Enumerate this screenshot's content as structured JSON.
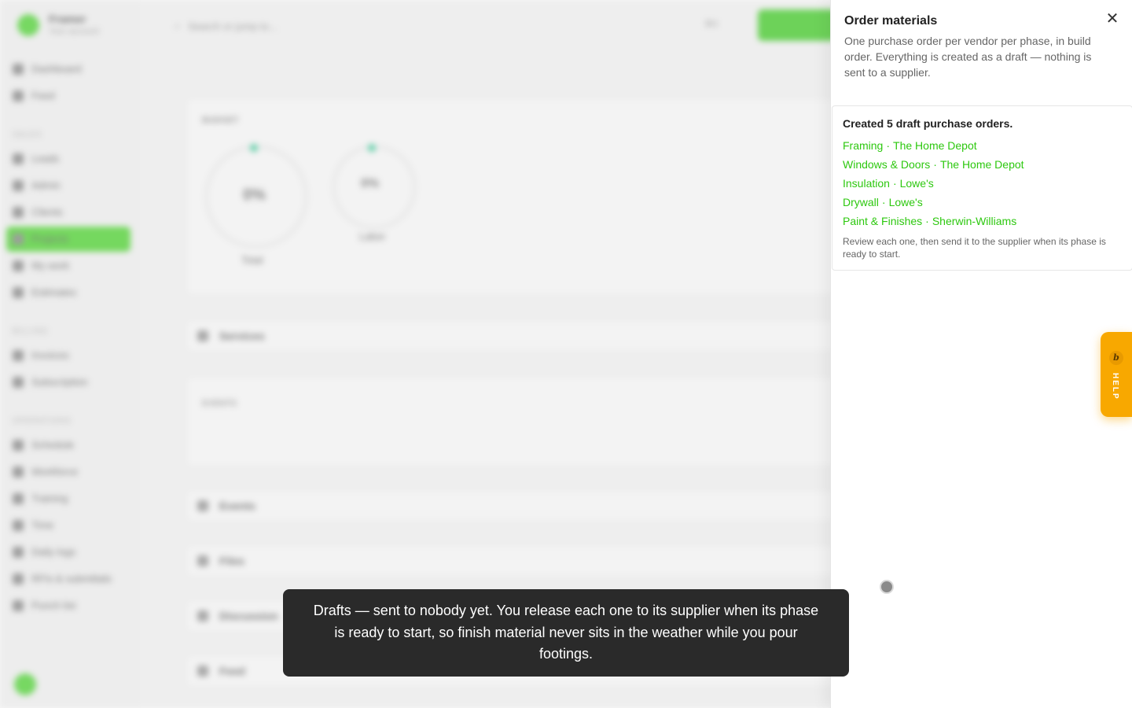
{
  "drawer": {
    "title": "Order materials",
    "description": "One purchase order per vendor per phase, in build order. Everything is created as a draft — nothing is sent to a supplier.",
    "close_icon": "close-icon",
    "result": {
      "heading": "Created 5 draft purchase orders.",
      "orders": [
        {
          "phase": "Framing",
          "vendor": "The Home Depot"
        },
        {
          "phase": "Windows & Doors",
          "vendor": "The Home Depot"
        },
        {
          "phase": "Insulation",
          "vendor": "Lowe's"
        },
        {
          "phase": "Drywall",
          "vendor": "Lowe's"
        },
        {
          "phase": "Paint & Finishes",
          "vendor": "Sherwin-Williams"
        }
      ],
      "separator": "·",
      "note": "Review each one, then send it to the supplier when its phase is ready to start."
    }
  },
  "help_tab": {
    "label": "HELP",
    "badge": "b"
  },
  "caption": {
    "text": "Drafts — sent to nobody yet. You release each one to its supplier when its phase is ready to start, so finish material never sits in the weather while you pour footings."
  },
  "background": {
    "brand": "Framer",
    "brand_sub": "Your account",
    "search_placeholder": "Search or jump to...",
    "nav": [
      "Dashboard",
      "Feed",
      "Leads",
      "Admin",
      "Clients",
      "Projects",
      "My work",
      "Estimates",
      "Invoices",
      "Subscription",
      "Schedule",
      "Workforce",
      "Training",
      "Time",
      "Daily logs",
      "RFIs & submittals",
      "Punch list"
    ],
    "budget_title": "BUDGET",
    "ring_total_pct": "0%",
    "ring_total_label": "Total",
    "ring_labor_pct": "0%",
    "ring_labor_label": "Labor",
    "sections": [
      "Services",
      "EVENTS",
      "Events",
      "Files",
      "Discussion",
      "Feed"
    ]
  },
  "colors": {
    "accent": "#2dc80f",
    "help": "#f8a800",
    "caption_bg": "#2a2a2a"
  }
}
